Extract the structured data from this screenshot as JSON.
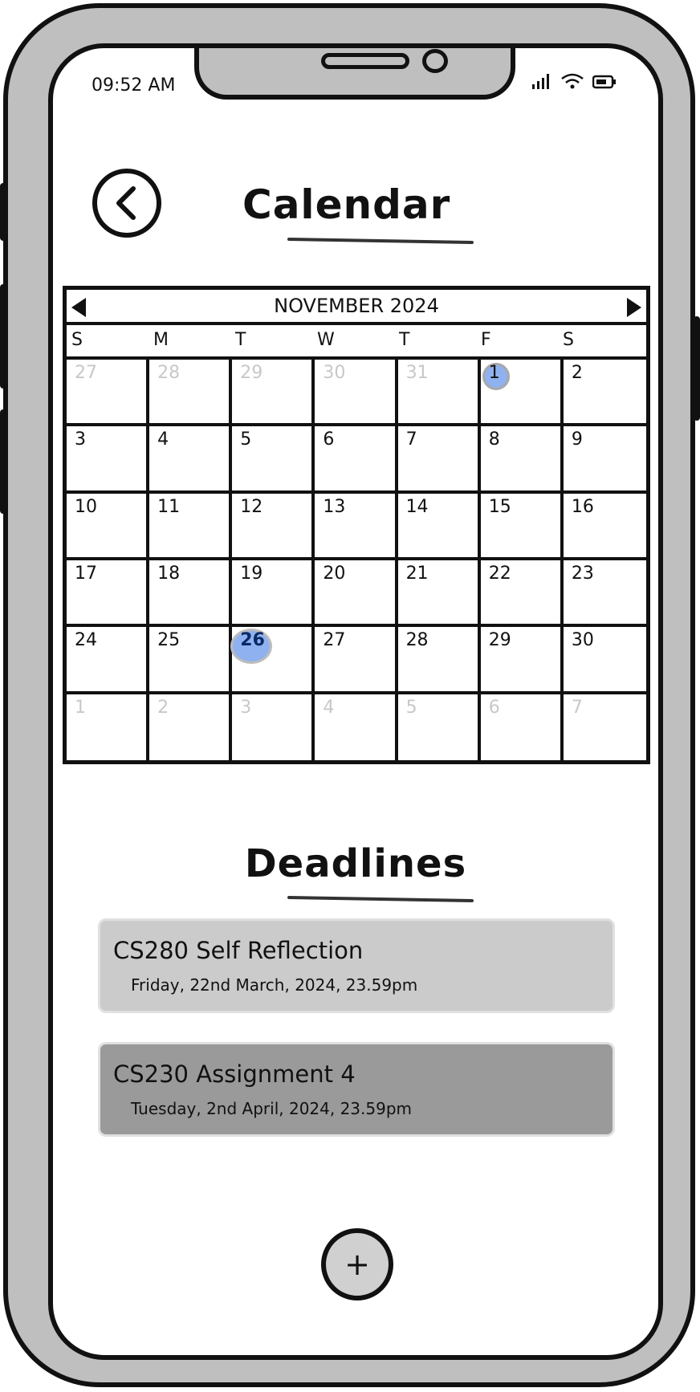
{
  "status_bar": {
    "time": "09:52 AM",
    "icons": [
      "signal-icon",
      "wifi-icon",
      "battery-icon"
    ]
  },
  "header": {
    "title": "Calendar",
    "back_icon": "chevron-left-icon"
  },
  "calendar": {
    "month_label": "NOVEMBER 2024",
    "weekdays": [
      "S",
      "M",
      "T",
      "W",
      "T",
      "F",
      "S"
    ],
    "days": [
      {
        "label": "27",
        "muted": true
      },
      {
        "label": "28",
        "muted": true
      },
      {
        "label": "29",
        "muted": true
      },
      {
        "label": "30",
        "muted": true
      },
      {
        "label": "31",
        "muted": true
      },
      {
        "label": "1",
        "highlight": true
      },
      {
        "label": "2"
      },
      {
        "label": "3"
      },
      {
        "label": "4"
      },
      {
        "label": "5"
      },
      {
        "label": "6"
      },
      {
        "label": "7"
      },
      {
        "label": "8"
      },
      {
        "label": "9"
      },
      {
        "label": "10"
      },
      {
        "label": "11"
      },
      {
        "label": "12"
      },
      {
        "label": "13"
      },
      {
        "label": "14"
      },
      {
        "label": "15"
      },
      {
        "label": "16"
      },
      {
        "label": "17"
      },
      {
        "label": "18"
      },
      {
        "label": "19"
      },
      {
        "label": "20"
      },
      {
        "label": "21"
      },
      {
        "label": "22"
      },
      {
        "label": "23"
      },
      {
        "label": "24"
      },
      {
        "label": "25"
      },
      {
        "label": "26",
        "today": true
      },
      {
        "label": "27"
      },
      {
        "label": "28"
      },
      {
        "label": "29"
      },
      {
        "label": "30"
      },
      {
        "label": "1",
        "muted": true
      },
      {
        "label": "2",
        "muted": true
      },
      {
        "label": "3",
        "muted": true
      },
      {
        "label": "4",
        "muted": true
      },
      {
        "label": "5",
        "muted": true
      },
      {
        "label": "6",
        "muted": true
      },
      {
        "label": "7",
        "muted": true
      }
    ],
    "highlight_color": "#8fb1f0"
  },
  "deadlines": {
    "title": "Deadlines",
    "items": [
      {
        "name": "CS280 Self Reflection",
        "due": "Friday, 22nd March, 2024, 23.59pm",
        "color": "#cbcbcb"
      },
      {
        "name": "CS230 Assignment 4",
        "due": "Tuesday, 2nd April, 2024, 23.59pm",
        "color": "#9a9a9a"
      }
    ]
  },
  "add_button": {
    "label": "+"
  }
}
